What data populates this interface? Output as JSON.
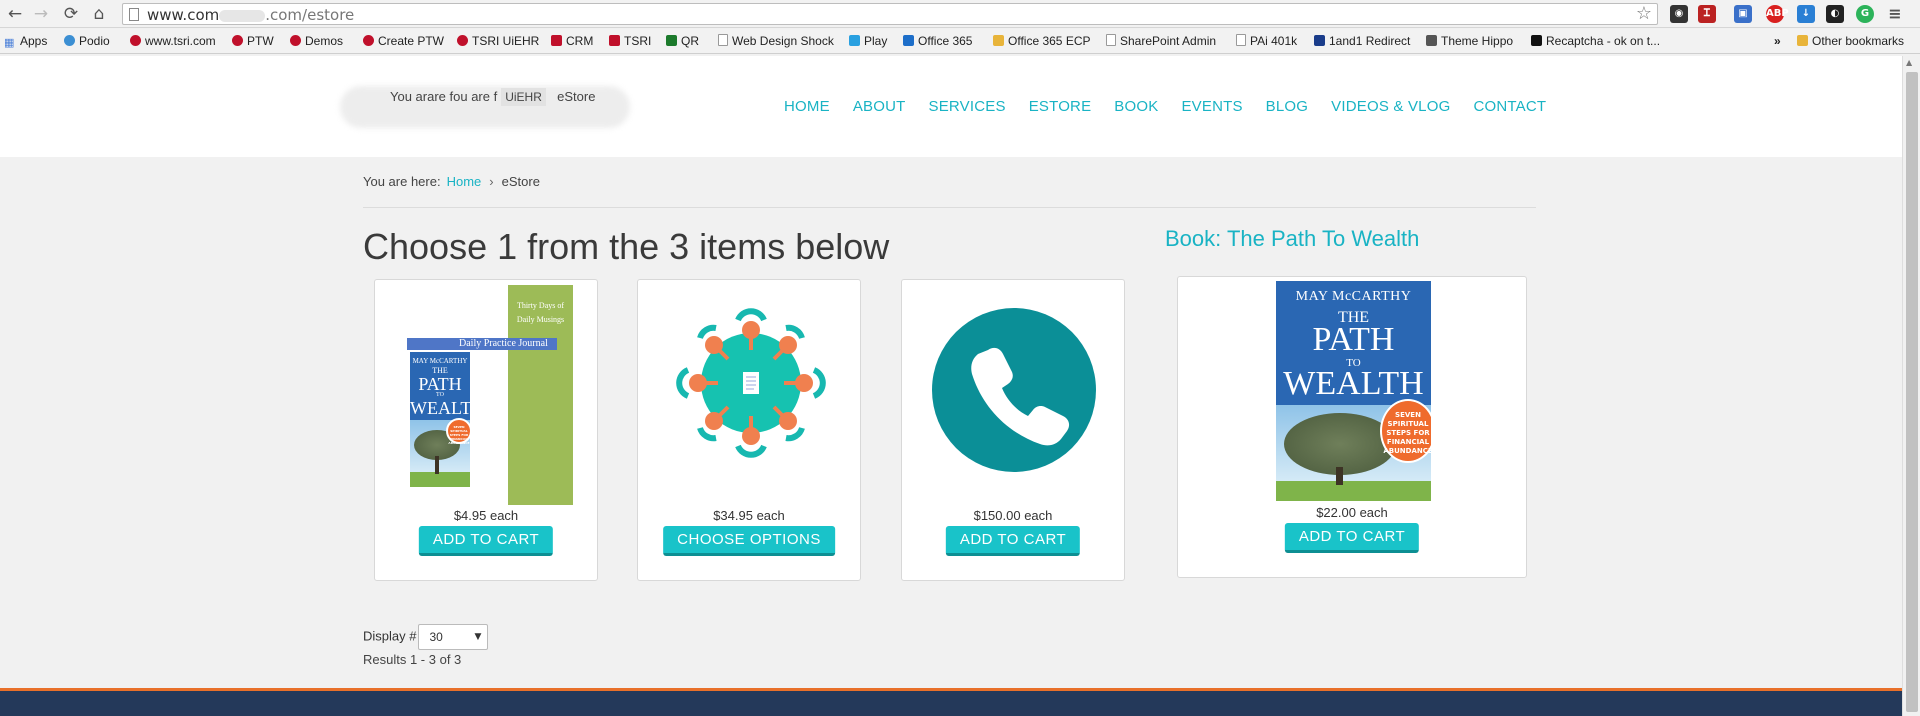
{
  "browser": {
    "url_prefix": "www.com",
    "url_suffix": ".com/estore",
    "bookmarks": [
      {
        "label": "Apps",
        "icon": "apps-grid-icon"
      },
      {
        "label": "Podio",
        "icon": "podio-icon"
      },
      {
        "label": "www.tsri.com",
        "icon": "tsri-icon"
      },
      {
        "label": "PTW",
        "icon": "tsri-icon"
      },
      {
        "label": "Demos",
        "icon": "tsri-icon"
      },
      {
        "label": "Create PTW",
        "icon": "tsri-icon"
      },
      {
        "label": "TSRI UiEHR",
        "icon": "tsri-icon"
      },
      {
        "label": "CRM",
        "icon": "crm-icon"
      },
      {
        "label": "TSRI",
        "icon": "crm-icon"
      },
      {
        "label": "QR",
        "icon": "qr-icon"
      },
      {
        "label": "Web Design Shock",
        "icon": "page-icon"
      },
      {
        "label": "Play",
        "icon": "play-icon"
      },
      {
        "label": "Office 365",
        "icon": "sharepoint-icon"
      },
      {
        "label": "Office 365 ECP",
        "icon": "folder-icon"
      },
      {
        "label": "SharePoint Admin",
        "icon": "page-icon"
      },
      {
        "label": "PAi 401k",
        "icon": "page-icon"
      },
      {
        "label": "1and1 Redirect",
        "icon": "1and1-icon"
      },
      {
        "label": "Theme Hippo",
        "icon": "hippo-icon"
      },
      {
        "label": "Recaptcha - ok on t...",
        "icon": "recaptcha-icon"
      }
    ],
    "overflow_label": "»",
    "other_bookmarks": "Other bookmarks"
  },
  "header": {
    "logo_parts": [
      "You arare fou are f",
      "UiEHR",
      "eStore"
    ],
    "nav": [
      "HOME",
      "ABOUT",
      "SERVICES",
      "ESTORE",
      "BOOK",
      "EVENTS",
      "BLOG",
      "VIDEOS & VLOG",
      "CONTACT"
    ]
  },
  "breadcrumb": {
    "prefix": "You are here:",
    "home": "Home",
    "separator": "›",
    "current": "eStore"
  },
  "page_title": "Choose 1 from the 3 items below",
  "side_title": "Book: The Path To Wealth",
  "products": [
    {
      "price": "$4.95 each",
      "button": "ADD TO CART",
      "journal_title_1": "Thirty Days of",
      "journal_title_2": "Daily Musings",
      "journal_label": "Daily Practice Journal",
      "author": "MAY McCARTHY",
      "title_1": "THE",
      "title_2": "PATH",
      "title_3": "TO",
      "title_4": "WEALTH",
      "badge_1": "SEVEN",
      "badge_2": "SPIRITUAL",
      "badge_3": "STEPS FOR",
      "badge_4": "FINANCIAL",
      "badge_5": "ABUNDANCE"
    },
    {
      "price": "$34.95 each",
      "button": "CHOOSE OPTIONS",
      "icon": "meeting-table-icon"
    },
    {
      "price": "$150.00 each",
      "button": "ADD TO CART",
      "icon": "phone-icon"
    }
  ],
  "featured": {
    "price": "$22.00 each",
    "button": "ADD TO CART",
    "author": "MAY McCARTHY",
    "title_1": "THE",
    "title_2": "PATH",
    "title_3": "TO",
    "title_4": "WEALTH",
    "badge_1": "SEVEN",
    "badge_2": "SPIRITUAL",
    "badge_3": "STEPS FOR",
    "badge_4": "FINANCIAL",
    "badge_5": "ABUNDANCE"
  },
  "display": {
    "label": "Display #",
    "value": "30"
  },
  "results": "Results 1 - 3 of 3",
  "colors": {
    "accent": "#19b3c4",
    "button": "#19c3c9",
    "footer": "#24395a",
    "footer_stripe": "#e8702a",
    "phone_circle": "#0b8f97"
  }
}
